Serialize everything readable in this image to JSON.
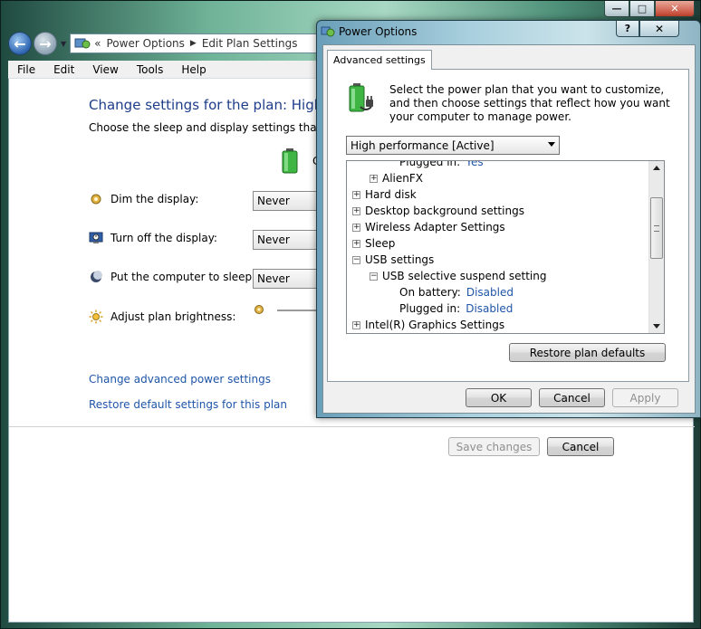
{
  "window": {
    "minimize_glyph": "—",
    "maximize_glyph": "□",
    "close_glyph": "✕"
  },
  "nav": {
    "back_glyph": "←",
    "forward_glyph": "→",
    "crumb_prefix": "«",
    "crumbs": [
      "Power Options",
      "Edit Plan Settings"
    ]
  },
  "menu": [
    "File",
    "Edit",
    "View",
    "Tools",
    "Help"
  ],
  "page": {
    "title": "Change settings for the plan: High pe",
    "subtitle": "Choose the sleep and display settings that you w",
    "battery_column_label": "C",
    "settings": [
      {
        "label": "Dim the display:",
        "value": "Never",
        "icon": "dim-display-icon"
      },
      {
        "label": "Turn off the display:",
        "value": "Never",
        "icon": "display-off-icon"
      },
      {
        "label": "Put the computer to sleep:",
        "value": "Never",
        "icon": "sleep-moon-icon"
      },
      {
        "label": "Adjust plan brightness:",
        "value": "",
        "icon": "brightness-sun-icon"
      }
    ],
    "links": {
      "advanced": "Change advanced power settings",
      "restore": "Restore default settings for this plan"
    },
    "buttons": {
      "save": "Save changes",
      "cancel": "Cancel"
    }
  },
  "dialog": {
    "title": "Power Options",
    "help_glyph": "?",
    "close_glyph": "✕",
    "tab": "Advanced settings",
    "intro": "Select the power plan that you want to customize, and then choose settings that reflect how you want your computer to manage power.",
    "plan_selected": "High performance [Active]",
    "tree": [
      {
        "label": "Plugged in:",
        "value": "Yes",
        "level": 3,
        "expander": ""
      },
      {
        "label": "AlienFX",
        "value": "",
        "level": 1,
        "expander": "+"
      },
      {
        "label": "Hard disk",
        "value": "",
        "level": 0,
        "expander": "+"
      },
      {
        "label": "Desktop background settings",
        "value": "",
        "level": 0,
        "expander": "+"
      },
      {
        "label": "Wireless Adapter Settings",
        "value": "",
        "level": 0,
        "expander": "+"
      },
      {
        "label": "Sleep",
        "value": "",
        "level": 0,
        "expander": "+"
      },
      {
        "label": "USB settings",
        "value": "",
        "level": 0,
        "expander": "−"
      },
      {
        "label": "USB selective suspend setting",
        "value": "",
        "level": 1,
        "expander": "−"
      },
      {
        "label": "On battery:",
        "value": "Disabled",
        "level": 3,
        "expander": ""
      },
      {
        "label": "Plugged in:",
        "value": "Disabled",
        "level": 3,
        "expander": ""
      },
      {
        "label": "Intel(R) Graphics Settings",
        "value": "",
        "level": 0,
        "expander": "+"
      }
    ],
    "buttons": {
      "restore_defaults": "Restore plan defaults",
      "ok": "OK",
      "cancel": "Cancel",
      "apply": "Apply"
    }
  }
}
